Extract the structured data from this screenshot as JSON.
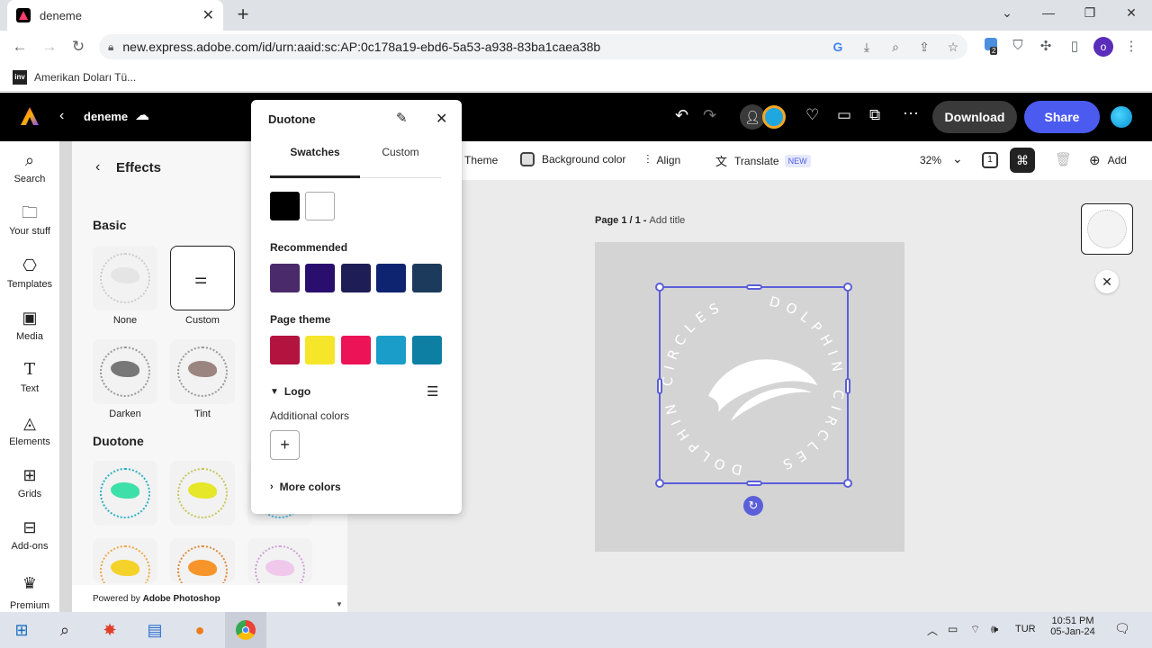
{
  "browser": {
    "tab_title": "deneme",
    "tab_close": "✕",
    "new_tab": "+",
    "url": "new.express.adobe.com/id/urn:aaid:sc:AP:0c178a19-ebd6-5a53-a938-83ba1caea38b",
    "bookmark_label": "Amerikan Doları Tü...",
    "bookmark_icon_text": "inv",
    "extension_badge": "2",
    "profile_initial": "o",
    "window_controls": [
      "⌄",
      "—",
      "❐",
      "✕"
    ]
  },
  "app": {
    "doc_title": "deneme",
    "download_label": "Download",
    "share_label": "Share"
  },
  "rail": {
    "items": [
      {
        "label": "Search",
        "icon": "search-icon"
      },
      {
        "label": "Your stuff",
        "icon": "folder-icon"
      },
      {
        "label": "Templates",
        "icon": "templates-icon"
      },
      {
        "label": "Media",
        "icon": "media-icon"
      },
      {
        "label": "Text",
        "icon": "text-icon"
      },
      {
        "label": "Elements",
        "icon": "elements-icon"
      },
      {
        "label": "Grids",
        "icon": "grids-icon"
      },
      {
        "label": "Add-ons",
        "icon": "addons-icon"
      },
      {
        "label": "Premium",
        "icon": "crown-icon"
      }
    ]
  },
  "effects": {
    "title": "Effects",
    "basic_heading": "Basic",
    "duotone_heading": "Duotone",
    "basic_items": [
      "None",
      "Custom",
      "Darken",
      "Tint"
    ],
    "powered_prefix": "Powered by ",
    "powered_brand": "Adobe Photoshop"
  },
  "duotone": {
    "title": "Duotone",
    "tabs": [
      "Swatches",
      "Custom"
    ],
    "base_colors": [
      "#000000",
      "#ffffff"
    ],
    "recommended_label": "Recommended",
    "recommended_colors": [
      "#4a2a6a",
      "#2a0e6e",
      "#1e1d55",
      "#0f2470",
      "#1c3a5c"
    ],
    "page_theme_label": "Page theme",
    "page_theme_colors": [
      "#b3133f",
      "#f5e62a",
      "#ec1357",
      "#1a9dc8",
      "#0c7fa3"
    ],
    "logo_label": "Logo",
    "additional_colors_label": "Additional colors",
    "more_colors_label": "More colors"
  },
  "context_bar": {
    "theme": "Theme",
    "background_color": "Background color",
    "align": "Align",
    "translate": "Translate",
    "new_badge": "NEW",
    "zoom": "32%",
    "add": "Add"
  },
  "canvas": {
    "page_label": "Page 1 / 1 - ",
    "add_title": "Add title",
    "logo_text": "DOLPHIN CIRCLES"
  },
  "taskbar": {
    "lang": "TUR",
    "time": "10:51 PM",
    "date": "05-Jan-24"
  }
}
